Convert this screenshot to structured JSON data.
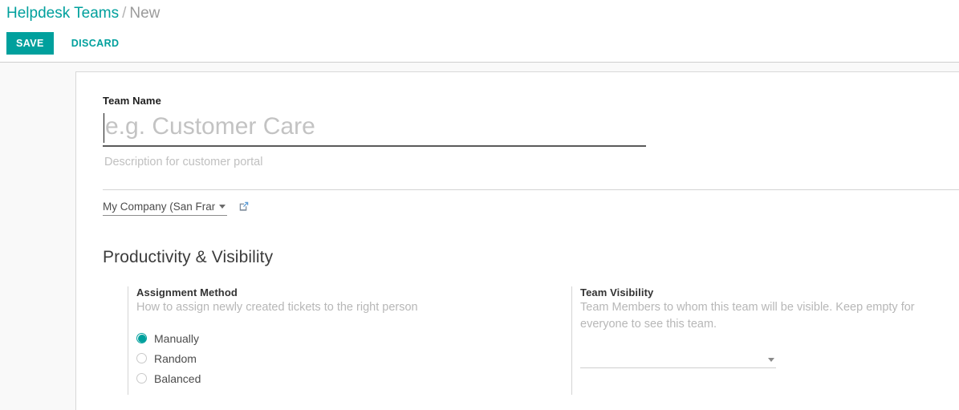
{
  "breadcrumb": {
    "root": "Helpdesk Teams",
    "separator": "/",
    "current": "New"
  },
  "toolbar": {
    "save_label": "SAVE",
    "discard_label": "DISCARD"
  },
  "form": {
    "team_name": {
      "label": "Team Name",
      "value": "",
      "placeholder": "e.g. Customer Care"
    },
    "description": {
      "value": "",
      "placeholder": "Description for customer portal"
    },
    "company": {
      "value": "My Company (San Franc",
      "external_link_icon": "external-link-icon",
      "dropdown_icon": "chevron-down-icon"
    }
  },
  "section": {
    "title": "Productivity & Visibility",
    "assignment_method": {
      "title": "Assignment Method",
      "help": "How to assign newly created tickets to the right person",
      "options": [
        {
          "label": "Manually",
          "selected": true
        },
        {
          "label": "Random",
          "selected": false
        },
        {
          "label": "Balanced",
          "selected": false
        }
      ]
    },
    "team_visibility": {
      "title": "Team Visibility",
      "help": "Team Members to whom this team will be visible. Keep empty for everyone to see this team.",
      "value": "",
      "dropdown_icon": "chevron-down-icon"
    }
  },
  "colors": {
    "accent": "#00a09d",
    "text": "#4c4c4c",
    "muted": "#b7b7b7",
    "page_bg": "#f9f9f9"
  }
}
